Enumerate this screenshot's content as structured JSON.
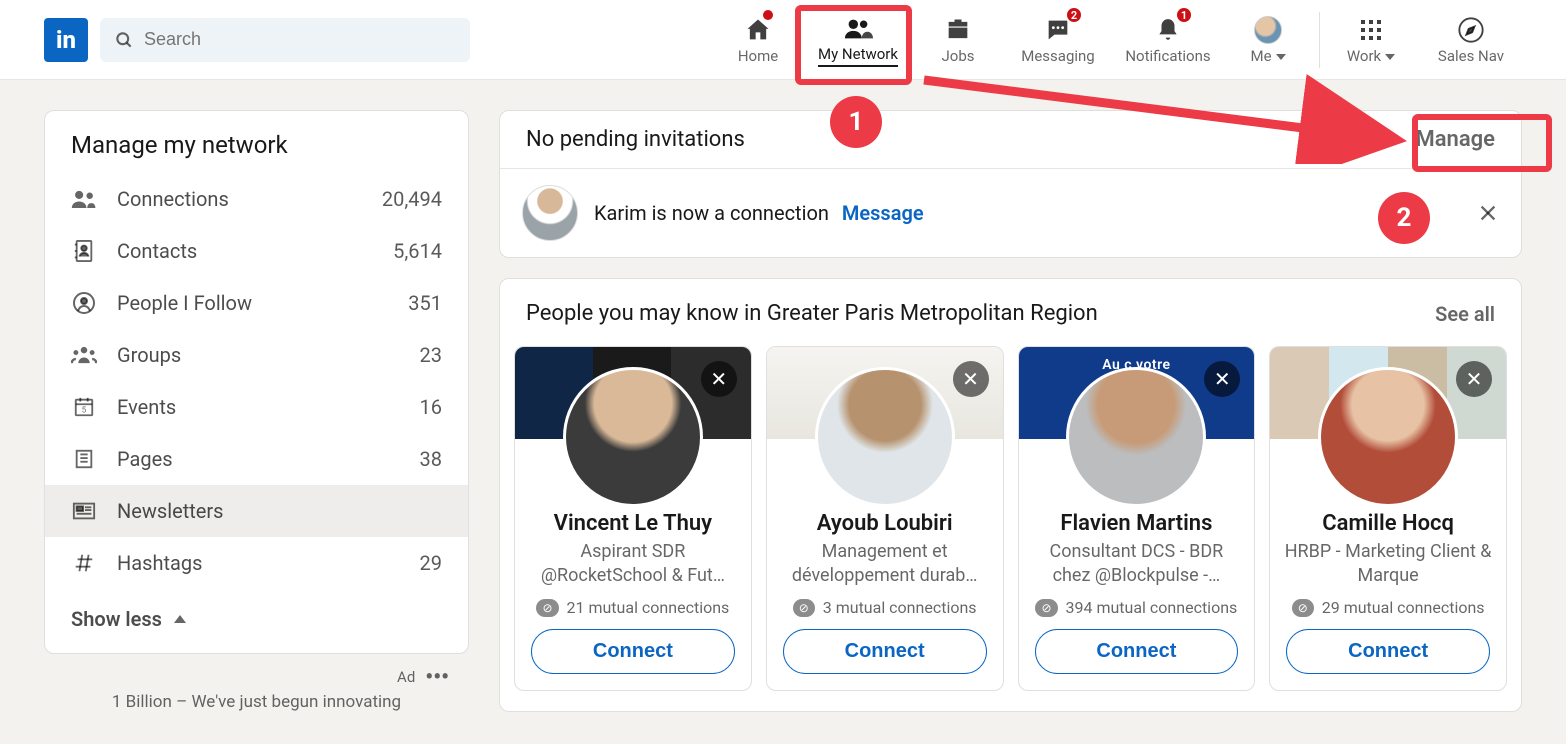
{
  "header": {
    "search_placeholder": "Search",
    "nav": {
      "home": "Home",
      "network": "My Network",
      "jobs": "Jobs",
      "messaging": "Messaging",
      "messaging_badge": "2",
      "notifications": "Notifications",
      "notifications_badge": "1",
      "me": "Me",
      "work": "Work",
      "sales": "Sales Nav"
    }
  },
  "sidebar": {
    "title": "Manage my network",
    "items": [
      {
        "label": "Connections",
        "count": "20,494"
      },
      {
        "label": "Contacts",
        "count": "5,614"
      },
      {
        "label": "People I Follow",
        "count": "351"
      },
      {
        "label": "Groups",
        "count": "23"
      },
      {
        "label": "Events",
        "count": "16"
      },
      {
        "label": "Pages",
        "count": "38"
      },
      {
        "label": "Newsletters",
        "count": ""
      },
      {
        "label": "Hashtags",
        "count": "29"
      }
    ],
    "show_less": "Show less",
    "ad_label": "Ad",
    "ad_tagline": "1 Billion – We've just begun innovating"
  },
  "invitations": {
    "heading": "No pending invitations",
    "manage": "Manage",
    "row_text": "Karim is now a connection",
    "row_action": "Message"
  },
  "pymk": {
    "heading": "People you may know in Greater Paris Metropolitan Region",
    "see_all": "See all",
    "connect_label": "Connect",
    "people": [
      {
        "name": "Vincent Le Thuy",
        "desc": "Aspirant SDR @RocketSchool & Fut…",
        "mutual": "21 mutual connections"
      },
      {
        "name": "Ayoub Loubiri",
        "desc": "Management et développement durab…",
        "mutual": "3 mutual connections"
      },
      {
        "name": "Flavien Martins",
        "desc": "Consultant DCS - BDR chez @Blockpulse -…",
        "mutual": "394 mutual connections",
        "cover_text": "Au c       votre"
      },
      {
        "name": "Camille Hocq",
        "desc": "HRBP - Marketing Client & Marque",
        "mutual": "29 mutual connections"
      }
    ]
  },
  "annotations": {
    "num1": "1",
    "num2": "2"
  }
}
